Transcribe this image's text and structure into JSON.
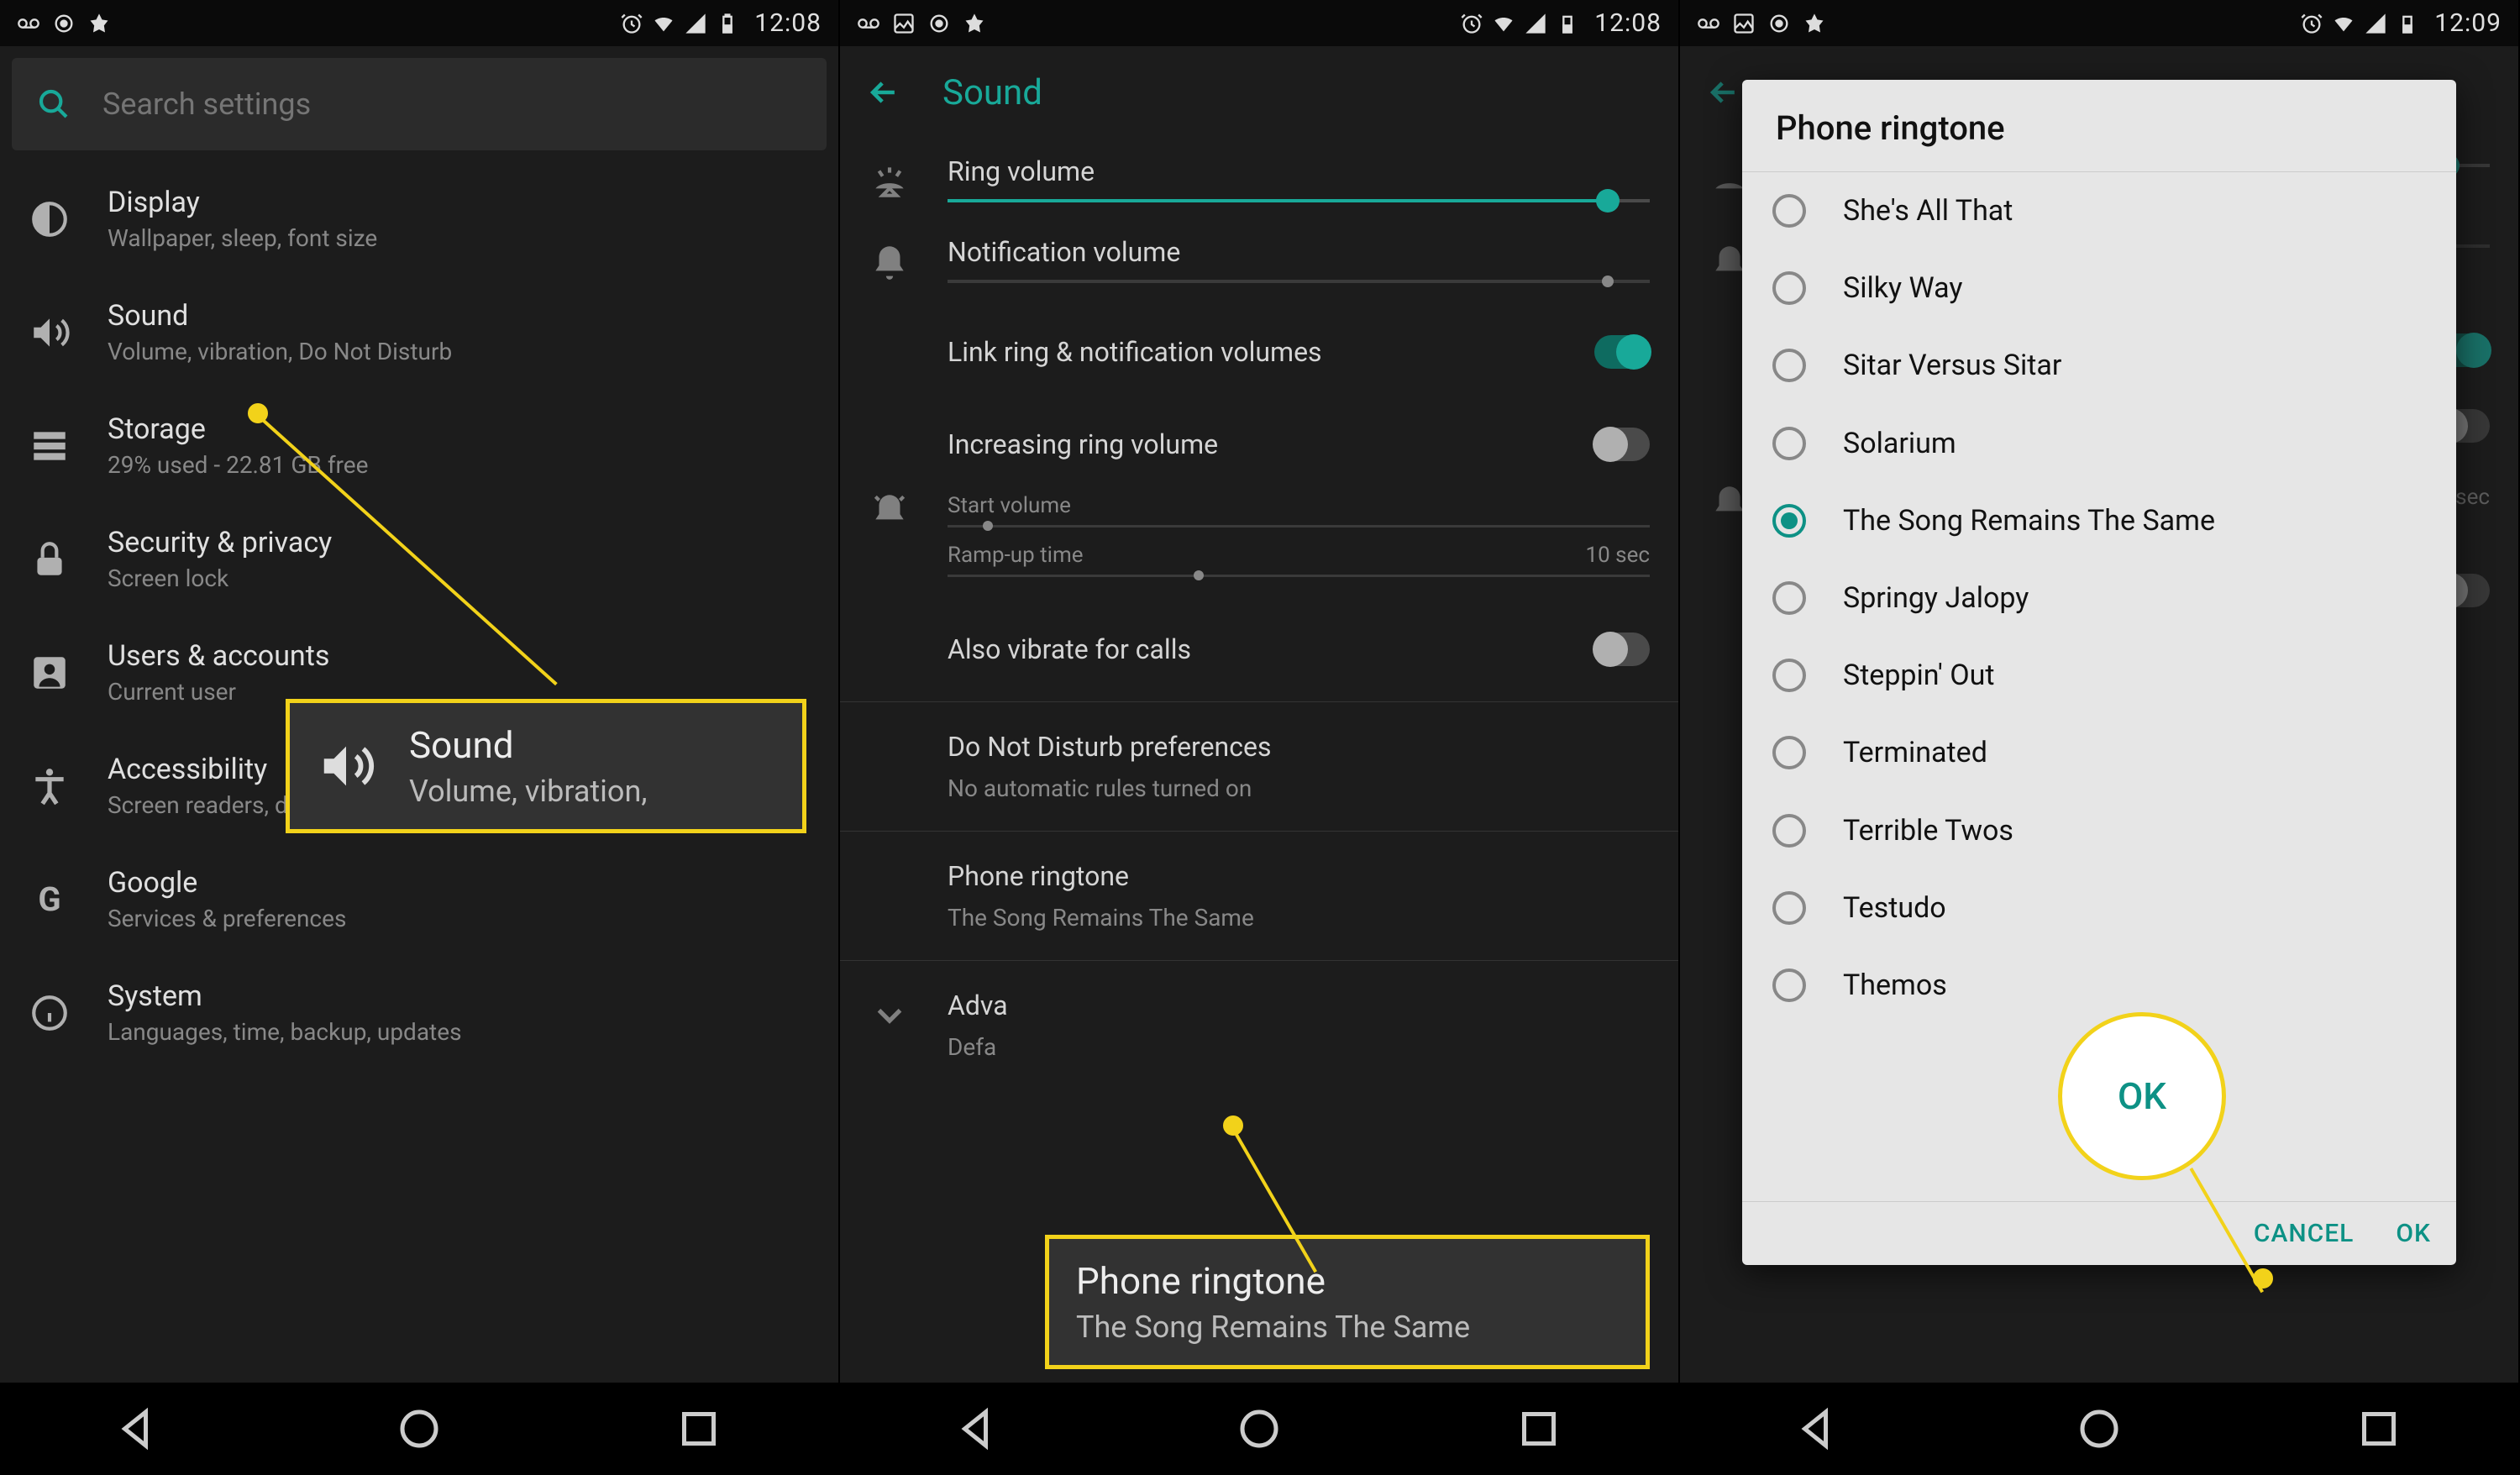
{
  "screen1": {
    "status_time": "12:08",
    "search_placeholder": "Search settings",
    "items": [
      {
        "title": "Display",
        "sub": "Wallpaper, sleep, font size"
      },
      {
        "title": "Sound",
        "sub": "Volume, vibration, Do Not Disturb"
      },
      {
        "title": "Storage",
        "sub": "29% used - 22.81 GB free"
      },
      {
        "title": "Security & privacy",
        "sub": "Screen lock"
      },
      {
        "title": "Users & accounts",
        "sub": "Current user"
      },
      {
        "title": "Accessibility",
        "sub": "Screen readers, display, interaction controls"
      },
      {
        "title": "Google",
        "sub": "Services & preferences"
      },
      {
        "title": "System",
        "sub": "Languages, time, backup, updates"
      }
    ],
    "callout": {
      "title": "Sound",
      "sub": "Volume, vibration,"
    }
  },
  "screen2": {
    "status_time": "12:08",
    "title": "Sound",
    "ring_volume": "Ring volume",
    "notif_volume": "Notification volume",
    "link_volumes": "Link ring & notification volumes",
    "increasing": "Increasing ring volume",
    "start_volume": "Start volume",
    "rampup": "Ramp-up time",
    "rampup_val": "10 sec",
    "also_vibrate": "Also vibrate for calls",
    "dnd_title": "Do Not Disturb preferences",
    "dnd_sub": "No automatic rules turned on",
    "ringtone_title": "Phone ringtone",
    "ringtone_sub": "The Song Remains The Same",
    "advanced": "Adva",
    "advanced_sub": "Defa",
    "callout": {
      "title": "Phone ringtone",
      "sub": "The Song Remains The Same"
    }
  },
  "screen3": {
    "status_time": "12:09",
    "dialog_title": "Phone ringtone",
    "options": [
      {
        "label": "She's All That",
        "selected": false
      },
      {
        "label": "Silky Way",
        "selected": false
      },
      {
        "label": "Sitar Versus Sitar",
        "selected": false
      },
      {
        "label": "Solarium",
        "selected": false
      },
      {
        "label": "The Song Remains The Same",
        "selected": true
      },
      {
        "label": "Springy Jalopy",
        "selected": false
      },
      {
        "label": "Steppin' Out",
        "selected": false
      },
      {
        "label": "Terminated",
        "selected": false
      },
      {
        "label": "Terrible Twos",
        "selected": false
      },
      {
        "label": "Testudo",
        "selected": false
      },
      {
        "label": "Themos",
        "selected": false
      }
    ],
    "cancel": "CANCEL",
    "ok": "OK",
    "circle_text": "OK"
  }
}
